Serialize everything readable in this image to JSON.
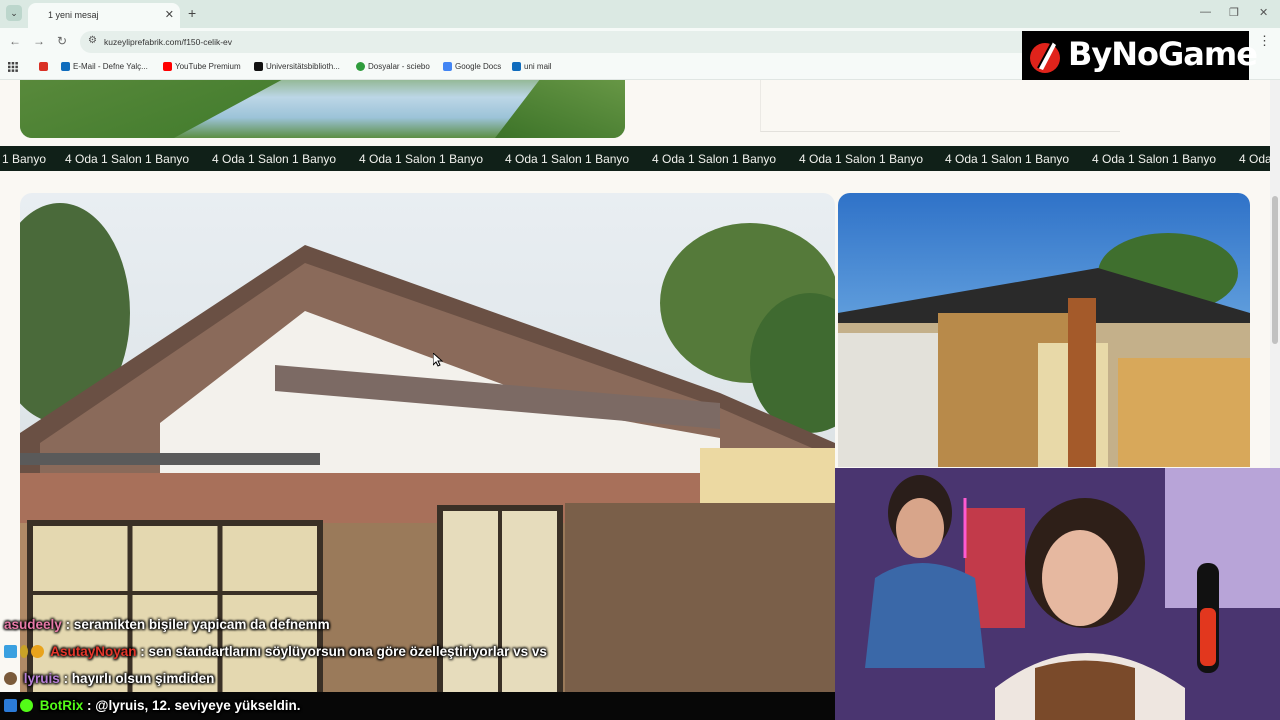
{
  "browser": {
    "tab_title": "1 yeni mesaj",
    "url": "kuzeyliprefabrik.com/f150-celik-ev",
    "bookmarks": [
      {
        "label": "",
        "icon": "gmail-icon",
        "color": "#d93025"
      },
      {
        "label": "E-Mail - Defne Yalç...",
        "icon": "outlook-icon",
        "color": "#0f6cbd"
      },
      {
        "label": "YouTube Premium",
        "icon": "youtube-icon",
        "color": "#ff0000"
      },
      {
        "label": "Universitätsbiblioth...",
        "icon": "library-icon",
        "color": "#111111"
      },
      {
        "label": "Dosyalar - sciebo",
        "icon": "sciebo-icon",
        "color": "#2e9c3c"
      },
      {
        "label": "Google Docs",
        "icon": "docs-icon",
        "color": "#4285f4"
      },
      {
        "label": "uni mail",
        "icon": "outlook-icon",
        "color": "#0f6cbd"
      }
    ]
  },
  "page": {
    "ticker_first": "1 Banyo",
    "ticker_item": "4 Oda 1 Salon 1 Banyo",
    "ticker_last": "4 Oda"
  },
  "overlay": {
    "logo_text": "ByNoGame",
    "chat": [
      {
        "user": "asudeely",
        "user_color": "#e87aa8",
        "message": ": seramikten bişiler yapicam da defnemm",
        "badges": []
      },
      {
        "user": "AsutayNoyan",
        "user_color": "#e5362b",
        "message": ": sen standartlarını söylüyorsun ona göre özelleştiriyorlar vs vs",
        "badges": [
          "#3aa0e0",
          "#c9a227",
          "#e8a31c"
        ]
      },
      {
        "user": "lyruis",
        "user_color": "#b77fd6",
        "message": ": hayırlı olsun şimdiden",
        "badges": [
          "#7a5a3a"
        ]
      },
      {
        "user": "BotRix",
        "user_color": "#53fc18",
        "message": ": @lyruis, 12. seviyeye yükseldin.",
        "badges": [
          "#2b7bd8",
          "#53fc18"
        ]
      }
    ]
  }
}
